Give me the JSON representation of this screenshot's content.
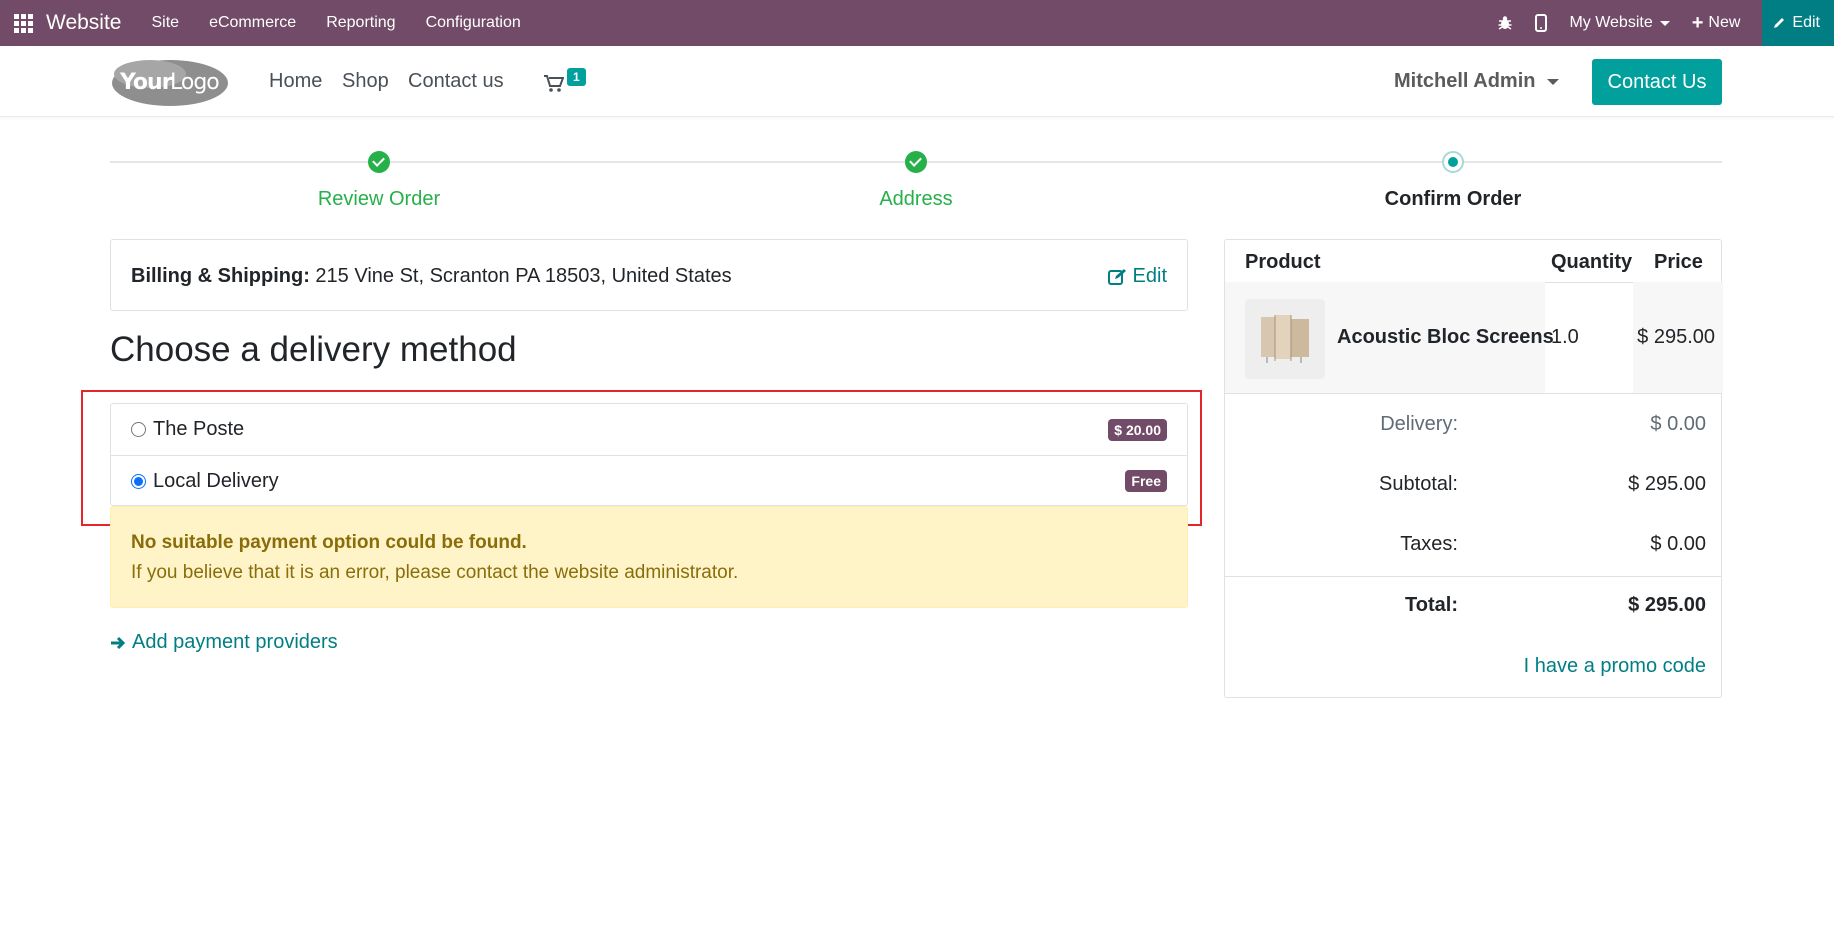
{
  "adminbar": {
    "brand": "Website",
    "menus": [
      "Site",
      "eCommerce",
      "Reporting",
      "Configuration"
    ],
    "website_selector": "My Website",
    "new_label": "New",
    "edit_label": "Edit"
  },
  "header": {
    "logo_text": "YourLogo",
    "nav": [
      "Home",
      "Shop",
      "Contact us"
    ],
    "cart_count": "1",
    "user_name": "Mitchell Admin",
    "contact_button": "Contact Us"
  },
  "steps": [
    {
      "label": "Review Order",
      "state": "done"
    },
    {
      "label": "Address",
      "state": "done"
    },
    {
      "label": "Confirm Order",
      "state": "current"
    }
  ],
  "billing": {
    "label": "Billing & Shipping:",
    "address": "215 Vine St, Scranton PA 18503, United States",
    "edit_label": "Edit"
  },
  "delivery": {
    "heading": "Choose a delivery method",
    "options": [
      {
        "name": "The Poste",
        "price": "$ 20.00",
        "selected": false
      },
      {
        "name": "Local Delivery",
        "price": "Free",
        "selected": true
      }
    ]
  },
  "alert": {
    "title": "No suitable payment option could be found.",
    "message": "If you believe that it is an error, please contact the website administrator."
  },
  "add_providers_label": "Add payment providers",
  "summary": {
    "headers": {
      "product": "Product",
      "quantity": "Quantity",
      "price": "Price"
    },
    "items": [
      {
        "name": "Acoustic Bloc Screens",
        "quantity": "1.0",
        "price": "$ 295.00"
      }
    ],
    "delivery_label": "Delivery:",
    "delivery_value": "$ 0.00",
    "subtotal_label": "Subtotal:",
    "subtotal_value": "$ 295.00",
    "taxes_label": "Taxes:",
    "taxes_value": "$ 0.00",
    "total_label": "Total:",
    "total_value": "$ 295.00",
    "promo_label": "I have a promo code"
  },
  "colors": {
    "admin_bar": "#714B67",
    "primary": "#01a09d",
    "link": "#017e84",
    "success": "#26b04a",
    "highlight_border": "#e3262b",
    "alert_bg": "#fff4c8"
  }
}
